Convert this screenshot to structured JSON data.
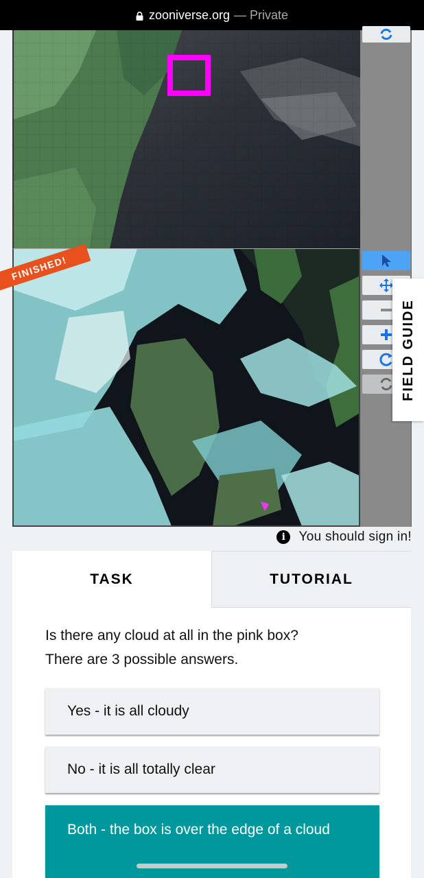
{
  "browser": {
    "domain": "zooniverse.org",
    "separator": "—",
    "mode": "Private"
  },
  "viewer": {
    "finished_badge": "FINISHED!",
    "tools": [
      "pointer-icon",
      "move-icon",
      "zoom-out-icon",
      "zoom-in-icon",
      "rotate-icon",
      "reset-icon"
    ],
    "field_guide_label": "FIELD GUIDE",
    "highlight_color": "#ff00ff"
  },
  "notice": {
    "sign_in_text": "You should sign in!"
  },
  "tabs": {
    "task": "TASK",
    "tutorial": "TUTORIAL"
  },
  "task": {
    "question": "Is there any cloud at all in the pink box?",
    "answer_count_text": "There are 3 possible answers.",
    "answers": [
      "Yes - it is all cloudy",
      "No - it is all totally clear",
      "Both - the box is over the edge of a cloud"
    ],
    "selected_index": 2,
    "accent_color": "#00979d"
  }
}
